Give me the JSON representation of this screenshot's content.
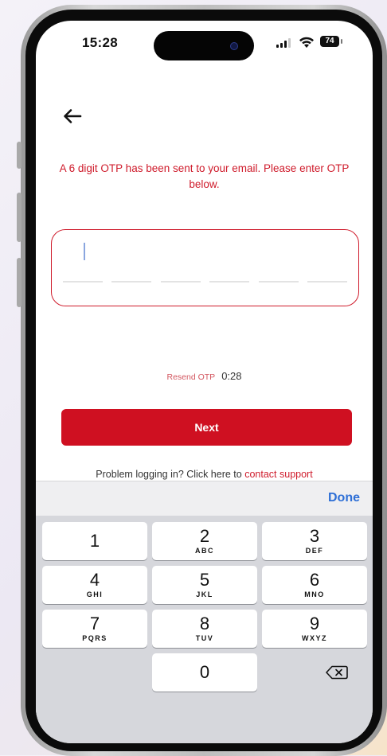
{
  "status_bar": {
    "time": "15:28",
    "battery": "74"
  },
  "otp": {
    "message": "A 6 digit OTP has been sent to your email. Please enter OTP below.",
    "digits": [
      "",
      "",
      "",
      "",
      "",
      ""
    ]
  },
  "resend": {
    "label": "Resend OTP",
    "timer": "0:28"
  },
  "next_button": {
    "label": "Next"
  },
  "support": {
    "prefix": "Problem logging in? Click here to",
    "link": "contact support"
  },
  "keyboard": {
    "done_label": "Done",
    "keys": [
      {
        "digit": "1",
        "letters": ""
      },
      {
        "digit": "2",
        "letters": "ABC"
      },
      {
        "digit": "3",
        "letters": "DEF"
      },
      {
        "digit": "4",
        "letters": "GHI"
      },
      {
        "digit": "5",
        "letters": "JKL"
      },
      {
        "digit": "6",
        "letters": "MNO"
      },
      {
        "digit": "7",
        "letters": "PQRS"
      },
      {
        "digit": "8",
        "letters": "TUV"
      },
      {
        "digit": "9",
        "letters": "WXYZ"
      },
      {
        "digit": "0",
        "letters": ""
      }
    ],
    "backspace_icon": "backspace-icon"
  },
  "colors": {
    "accent": "#cf1021",
    "done": "#2e6fd6"
  }
}
